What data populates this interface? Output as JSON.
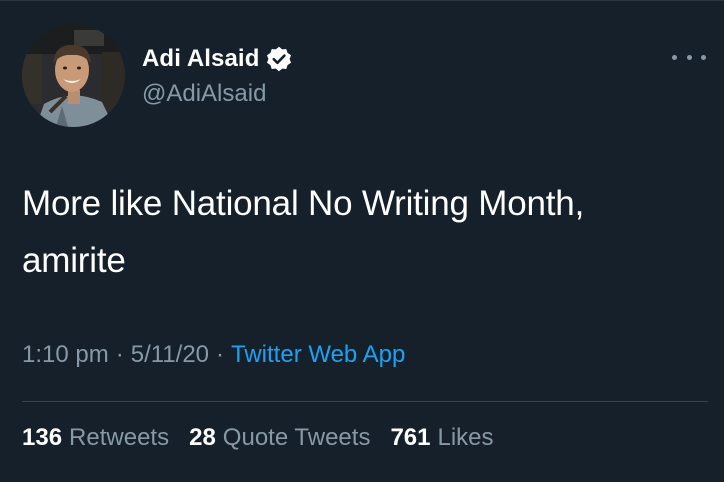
{
  "colors": {
    "background": "#15202b",
    "primary_text": "#ffffff",
    "secondary_text": "#8899a6",
    "accent": "#1da1f2",
    "divider": "#38444d"
  },
  "author": {
    "display_name": "Adi Alsaid",
    "handle": "@AdiAlsaid",
    "verified_icon": "verified-badge-icon",
    "avatar_icon": "profile-photo"
  },
  "more_icon": "more-options-icon",
  "tweet": {
    "text_line1": "More like National No Writing Month,",
    "text_line2": "amirite"
  },
  "meta": {
    "time": "1:10 pm",
    "separator": "·",
    "date": "5/11/20",
    "source": "Twitter Web App"
  },
  "stats": {
    "retweets": {
      "count": "136",
      "label": "Retweets"
    },
    "quotes": {
      "count": "28",
      "label": "Quote Tweets"
    },
    "likes": {
      "count": "761",
      "label": "Likes"
    }
  }
}
